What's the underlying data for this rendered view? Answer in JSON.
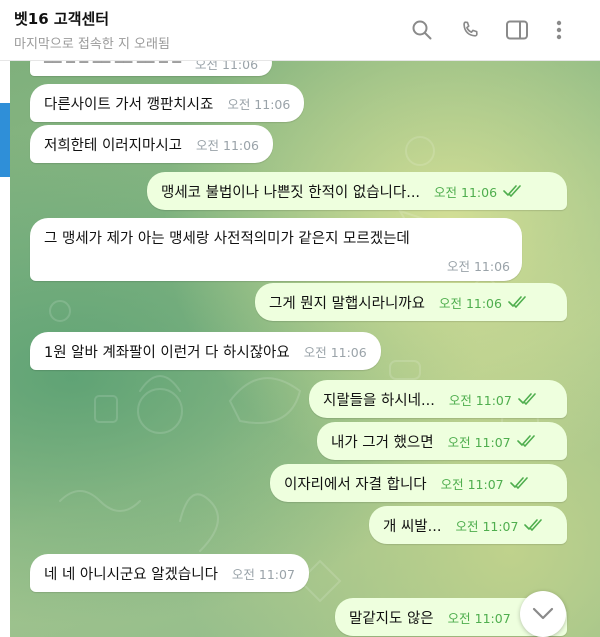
{
  "header": {
    "title": "벳16 고객센터",
    "subtitle": "마지막으로 접속한 지 오래됨"
  },
  "messages": [
    {
      "dir": "in",
      "text": "──  ─ ─  ── ──  ── ─ ─",
      "time": "오전 11:06"
    },
    {
      "dir": "in",
      "text": "다른사이트 가서 깽판치시죠",
      "time": "오전 11:06"
    },
    {
      "dir": "in",
      "text": "저희한테 이러지마시고",
      "time": "오전 11:06"
    },
    {
      "dir": "out",
      "text": "맹세코 불법이나 나쁜짓 한적이 없습니다...",
      "time": "오전 11:06"
    },
    {
      "dir": "in",
      "text": "그 맹세가 제가 아는 맹세랑 사전적의미가 같은지 모르겠는데",
      "time": "오전 11:06"
    },
    {
      "dir": "out",
      "text": "그게 뭔지 말햅시라니까요",
      "time": "오전 11:06"
    },
    {
      "dir": "in",
      "text": "1원 알바 계좌팔이 이런거 다 하시잖아요",
      "time": "오전 11:06"
    },
    {
      "dir": "out",
      "text": "지랄들을 하시네...",
      "time": "오전 11:07"
    },
    {
      "dir": "out",
      "text": "내가 그거 했으면",
      "time": "오전 11:07"
    },
    {
      "dir": "out",
      "text": "이자리에서 자결 합니다",
      "time": "오전 11:07"
    },
    {
      "dir": "out",
      "text": "개 씨발...",
      "time": "오전 11:07"
    },
    {
      "dir": "in",
      "text": "네 네 아니시군요 알겠습니다",
      "time": "오전 11:07"
    },
    {
      "dir": "out",
      "text": "말같지도 않은",
      "time": "오전 11:07"
    }
  ],
  "icons": {
    "search": "search-icon",
    "call": "phone-icon",
    "sidebar": "sidebar-toggle-icon",
    "more": "more-vertical-icon",
    "read": "double-check-icon",
    "scroll": "chevron-down-icon"
  },
  "colors": {
    "incoming_bubble": "#ffffff",
    "outgoing_bubble": "#eeffde",
    "outgoing_time": "#4fae4e",
    "accent_strip": "#2f8fd8"
  }
}
